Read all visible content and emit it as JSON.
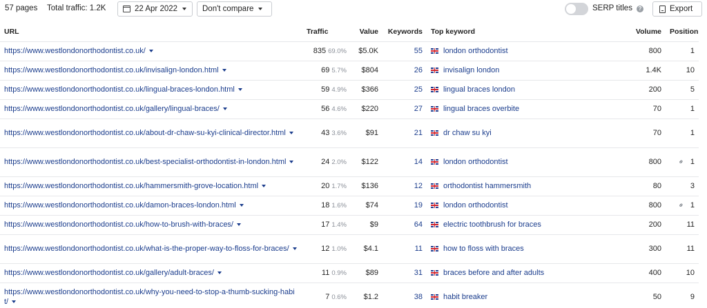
{
  "toolbar": {
    "pages": "57 pages",
    "total_traffic": "Total traffic: 1.2K",
    "date": "22 Apr 2022",
    "compare": "Don't compare",
    "serp_titles": "SERP titles",
    "serp_titles_on": false,
    "export": "Export"
  },
  "columns": {
    "url": "URL",
    "traffic": "Traffic",
    "value": "Value",
    "keywords": "Keywords",
    "top_keyword": "Top keyword",
    "volume": "Volume",
    "position": "Position"
  },
  "rows": [
    {
      "url": "https://www.westlondonorthodontist.co.uk/",
      "traffic": "835",
      "pct": "69.0%",
      "value": "$5.0K",
      "keywords": "55",
      "top_keyword": "london orthodontist",
      "volume": "800",
      "position": "1",
      "link": false
    },
    {
      "url": "https://www.westlondonorthodontist.co.uk/invisalign-london.html",
      "traffic": "69",
      "pct": "5.7%",
      "value": "$804",
      "keywords": "26",
      "top_keyword": "invisalign london",
      "volume": "1.4K",
      "position": "10",
      "link": false
    },
    {
      "url": "https://www.westlondonorthodontist.co.uk/lingual-braces-london.html",
      "traffic": "59",
      "pct": "4.9%",
      "value": "$366",
      "keywords": "25",
      "top_keyword": "lingual braces london",
      "volume": "200",
      "position": "5",
      "link": false
    },
    {
      "url": "https://www.westlondonorthodontist.co.uk/gallery/lingual-braces/",
      "traffic": "56",
      "pct": "4.6%",
      "value": "$220",
      "keywords": "27",
      "top_keyword": "lingual braces overbite",
      "volume": "70",
      "position": "1",
      "link": false
    },
    {
      "url": "https://www.westlondonorthodontist.co.uk/about-dr-chaw-su-kyi-clinical-director.html",
      "traffic": "43",
      "pct": "3.6%",
      "value": "$91",
      "keywords": "21",
      "top_keyword": "dr chaw su kyi",
      "volume": "70",
      "position": "1",
      "link": false
    },
    {
      "url": "https://www.westlondonorthodontist.co.uk/best-specialist-orthodontist-in-london.html",
      "traffic": "24",
      "pct": "2.0%",
      "value": "$122",
      "keywords": "14",
      "top_keyword": "london orthodontist",
      "volume": "800",
      "position": "1",
      "link": true
    },
    {
      "url": "https://www.westlondonorthodontist.co.uk/hammersmith-grove-location.html",
      "traffic": "20",
      "pct": "1.7%",
      "value": "$136",
      "keywords": "12",
      "top_keyword": "orthodontist hammersmith",
      "volume": "80",
      "position": "3",
      "link": false
    },
    {
      "url": "https://www.westlondonorthodontist.co.uk/damon-braces-london.html",
      "traffic": "18",
      "pct": "1.6%",
      "value": "$74",
      "keywords": "19",
      "top_keyword": "london orthodontist",
      "volume": "800",
      "position": "1",
      "link": true
    },
    {
      "url": "https://www.westlondonorthodontist.co.uk/how-to-brush-with-braces/",
      "traffic": "17",
      "pct": "1.4%",
      "value": "$9",
      "keywords": "64",
      "top_keyword": "electric toothbrush for braces",
      "volume": "200",
      "position": "11",
      "link": false
    },
    {
      "url": "https://www.westlondonorthodontist.co.uk/what-is-the-proper-way-to-floss-for-braces/",
      "traffic": "12",
      "pct": "1.0%",
      "value": "$4.1",
      "keywords": "11",
      "top_keyword": "how to floss with braces",
      "volume": "300",
      "position": "11",
      "link": false
    },
    {
      "url": "https://www.westlondonorthodontist.co.uk/gallery/adult-braces/",
      "traffic": "11",
      "pct": "0.9%",
      "value": "$89",
      "keywords": "31",
      "top_keyword": "braces before and after adults",
      "volume": "400",
      "position": "10",
      "link": false
    },
    {
      "url": "https://www.westlondonorthodontist.co.uk/why-you-need-to-stop-a-thumb-sucking-habit/",
      "traffic": "7",
      "pct": "0.6%",
      "value": "$1.2",
      "keywords": "38",
      "top_keyword": "habit breaker",
      "volume": "50",
      "position": "9",
      "link": false
    }
  ]
}
